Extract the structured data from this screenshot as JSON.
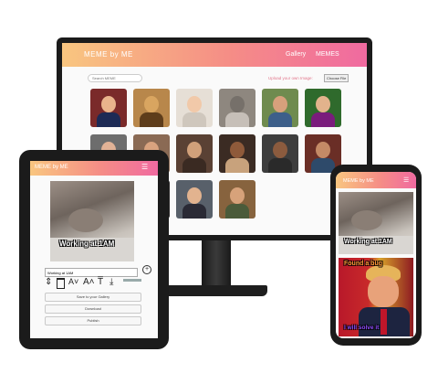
{
  "desktop": {
    "brand": "MEME by ME",
    "nav": [
      "Gallery",
      "MEMES"
    ],
    "search_placeholder": "Search MEME",
    "upload_label": "Upload your own Image:",
    "choose_file": "Choose File",
    "tile_colors": [
      [
        "#7a2a2a",
        "#e9b48c",
        "#1d2a55"
      ],
      [
        "#b8874b",
        "#d9a560",
        "#5e3d1b"
      ],
      [
        "#e6dfd6",
        "#f1c9a9",
        "#cfc7bd"
      ],
      [
        "#8e877f",
        "#76706a",
        "#c6bfb8"
      ],
      [
        "#6f8b4f",
        "#d8a07c",
        "#3d5f8a"
      ],
      [
        "#2f6a2c",
        "#e2b38c",
        "#7a1c7c"
      ],
      [
        "#6d6d6d",
        "#e1b296",
        "#3b3b3b"
      ],
      [
        "#8a6a54",
        "#d9a37f",
        "#4a3a2f"
      ],
      [
        "#5a4134",
        "#d1a07a",
        "#3a2a22"
      ],
      [
        "#3b2b23",
        "#8f5a3a",
        "#c8a27c"
      ],
      [
        "#3d3d3d",
        "#8b5b3e",
        "#2a2a2a"
      ],
      [
        "#6a2e26",
        "#c48a66",
        "#2e4a6a"
      ],
      [
        "#4a3626",
        "#c99570",
        "#22303e"
      ],
      [
        "#2c2a2a",
        "#e0b08b",
        "#1d2d44"
      ],
      [
        "#58606a",
        "#e2b38f",
        "#2a2a35"
      ],
      [
        "#87633e",
        "#d7a27a",
        "#4b5b3a"
      ]
    ]
  },
  "tablet": {
    "brand": "MEME by ME",
    "caption": "Working at 1AM",
    "input_value": "Working at 1AM",
    "add_icon": "plus-circle-icon",
    "tools": [
      "line-height-icon",
      "trash-icon",
      "decrease-font-icon",
      "increase-font-icon",
      "text-top-icon",
      "align-bottom-icon"
    ],
    "tool_glyphs": [
      "⇕",
      "🗑",
      "A˅",
      "A˄",
      "T̅",
      "⤓"
    ],
    "save_label": "Save to your Gallery",
    "download_label": "Download",
    "publish_label": "Publish"
  },
  "phone": {
    "brand": "MEME by ME",
    "meme1_caption": "Working at 1AM",
    "meme2_top": "Found a bug",
    "meme2_bottom": "I will solve it"
  },
  "colors": {
    "accent_gradient": [
      "#f9c680",
      "#f58d86",
      "#f06aa0"
    ],
    "device_frame": "#1b1b1b"
  }
}
